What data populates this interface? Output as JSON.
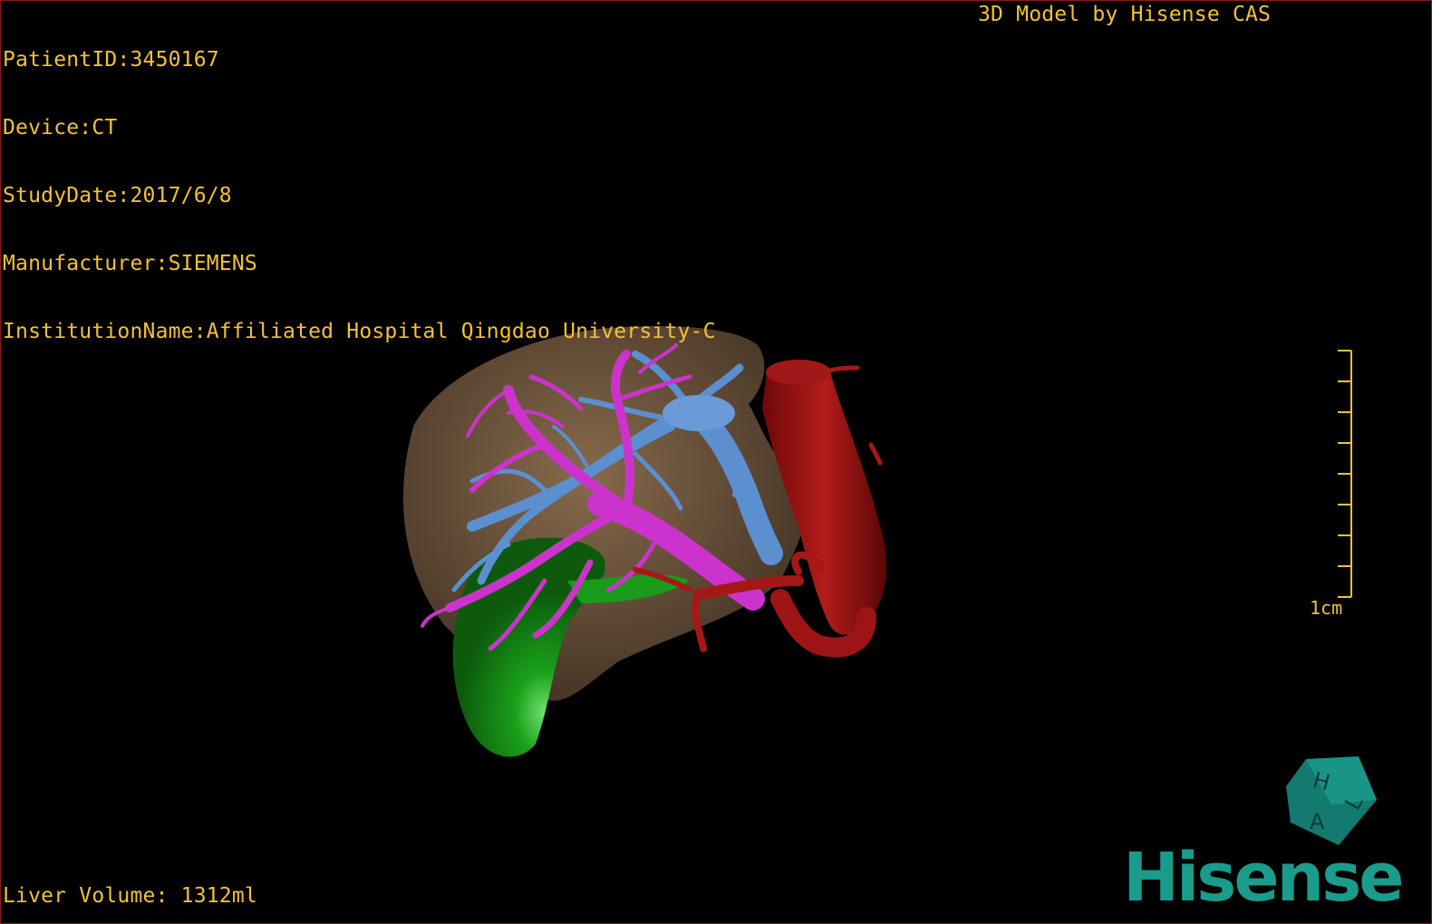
{
  "overlay": {
    "patient_id": "PatientID:3450167",
    "device": "Device:CT",
    "study_date": "StudyDate:2017/6/8",
    "manufacturer": "Manufacturer:SIEMENS",
    "institution": "InstitutionName:Affiliated Hospital Qingdao University-C",
    "model_by": "3D Model by Hisense CAS",
    "liver_volume": "Liver Volume: 1312ml"
  },
  "scale": {
    "label": "1cm"
  },
  "orientation_cube": {
    "labels": [
      "H",
      "A",
      "L"
    ]
  },
  "brand": {
    "logo_text": "Hisense"
  },
  "colors": {
    "overlay_text": "#f2c13a",
    "liver": "#7a6045",
    "gallbladder": "#1a9a1a",
    "portal_vein": "#cc33cc",
    "hepatic_vein": "#5b8fd0",
    "artery": "#9e1414",
    "brand": "#1a9c8c"
  },
  "structures": [
    "liver",
    "gallbladder",
    "portal-vein",
    "hepatic-vein",
    "artery"
  ]
}
